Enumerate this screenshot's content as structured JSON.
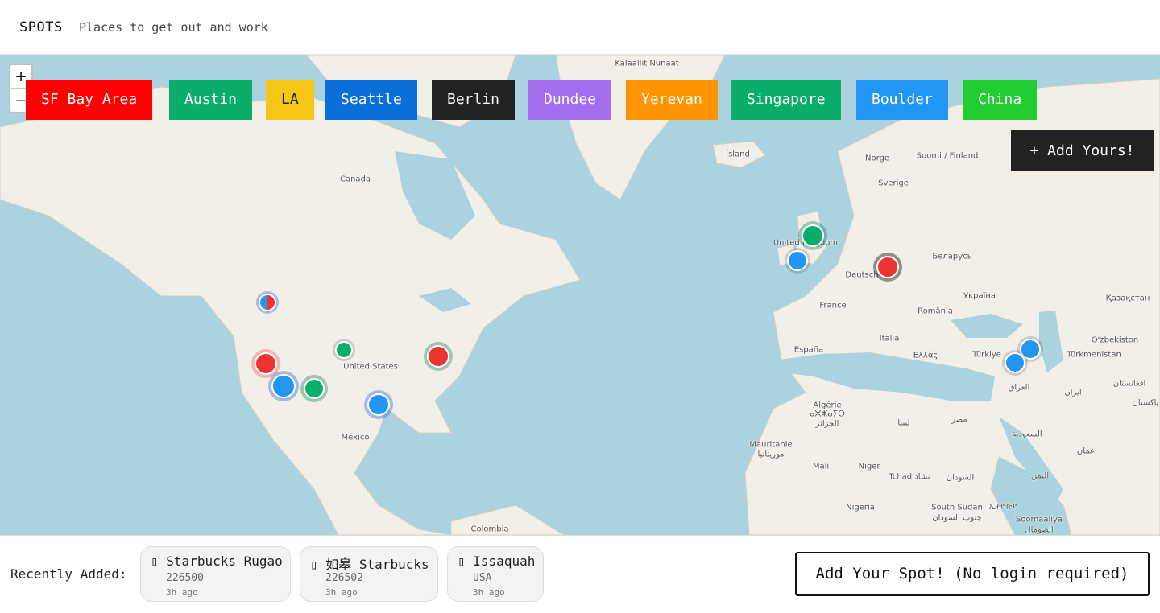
{
  "header": {
    "brand": "SPOTS",
    "tagline": "Places to get out and work"
  },
  "zoom": {
    "in": "+",
    "out": "−"
  },
  "cities": [
    {
      "label": "SF Bay Area",
      "color": "#ff0000"
    },
    {
      "label": "Austin",
      "color": "#0aae6a"
    },
    {
      "label": "LA",
      "color": "#f5c518"
    },
    {
      "label": "Seattle",
      "color": "#0a6fd8"
    },
    {
      "label": "Berlin",
      "color": "#222222"
    },
    {
      "label": "Dundee",
      "color": "#a66cf0"
    },
    {
      "label": "Yerevan",
      "color": "#ff9500"
    },
    {
      "label": "Singapore",
      "color": "#0aae6a"
    },
    {
      "label": "Boulder",
      "color": "#2196f3"
    },
    {
      "label": "China",
      "color": "#22cc33"
    }
  ],
  "add_yours": "+ Add Yours!",
  "map_labels": [
    "Kalaallit Nunaat",
    "Canada",
    "United States",
    "México",
    "Colombia",
    "Ísland",
    "Norge",
    "Suomi / Finland",
    "Sverige",
    "United Kingdom",
    "Deutsch",
    "Беларусь",
    "France",
    "Україна",
    "Қазақстан",
    "România",
    "España",
    "Italia",
    "Ελλάς",
    "Türkiye",
    "O'zbekiston",
    "Türkmenistan",
    "العراق",
    "ایران",
    "افغانستان",
    "پاکستان",
    "Algérie",
    "ⴰⵣⵣⴰⵢⵔ",
    "الجزائر",
    "ليبيا",
    "مصر",
    "السعودية",
    "عمان",
    "Mauritanie",
    "موريتانيا",
    "Mali",
    "Niger",
    "Tchad تشاد",
    "السودان",
    "اليمن",
    "Nigeria",
    "South Sudan",
    "جنوب السودان",
    "ኢትዮጵያ",
    "Soomaaliya",
    "الصومال"
  ],
  "recent": {
    "label": "Recently Added:",
    "items": [
      {
        "name": "Starbucks Rugao",
        "sub": "226500",
        "time": "3h ago"
      },
      {
        "name": "如皋 Starbucks",
        "sub": "226502",
        "time": "3h ago"
      },
      {
        "name": "Issaquah",
        "sub": "USA",
        "time": "3h ago"
      }
    ]
  },
  "add_spot": "Add Your Spot! (No login required)"
}
